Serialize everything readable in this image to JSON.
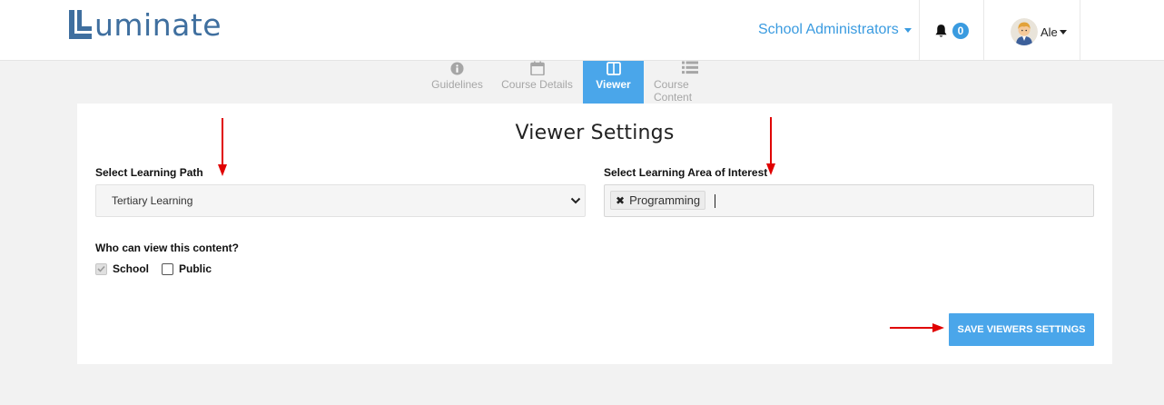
{
  "header": {
    "brand": "uminate",
    "role_menu_label": "School Administrators",
    "notifications_count": "0",
    "user_name": "Ale"
  },
  "tabs": [
    {
      "label": "Guidelines",
      "icon": "info-circle-icon",
      "active": false
    },
    {
      "label": "Course Details",
      "icon": "calendar-icon",
      "active": false
    },
    {
      "label": "Viewer",
      "icon": "columns-icon",
      "active": true
    },
    {
      "label": "Course Content",
      "icon": "list-icon",
      "active": false
    }
  ],
  "viewer_settings": {
    "title": "Viewer Settings",
    "learning_path_label": "Select Learning Path",
    "learning_path_value": "Tertiary Learning",
    "learning_area_label": "Select Learning Area of Interest",
    "learning_area_tags": [
      "Programming"
    ],
    "who_can_view_label": "Who can view this content?",
    "options": [
      {
        "label": "School",
        "checked": true,
        "disabled": true
      },
      {
        "label": "Public",
        "checked": false,
        "disabled": false
      }
    ],
    "save_label": "SAVE VIEWERS SETTINGS"
  },
  "colors": {
    "accent": "#4aa6ea",
    "brand": "#3f6f9f",
    "annotation_arrow": "#e00000"
  }
}
